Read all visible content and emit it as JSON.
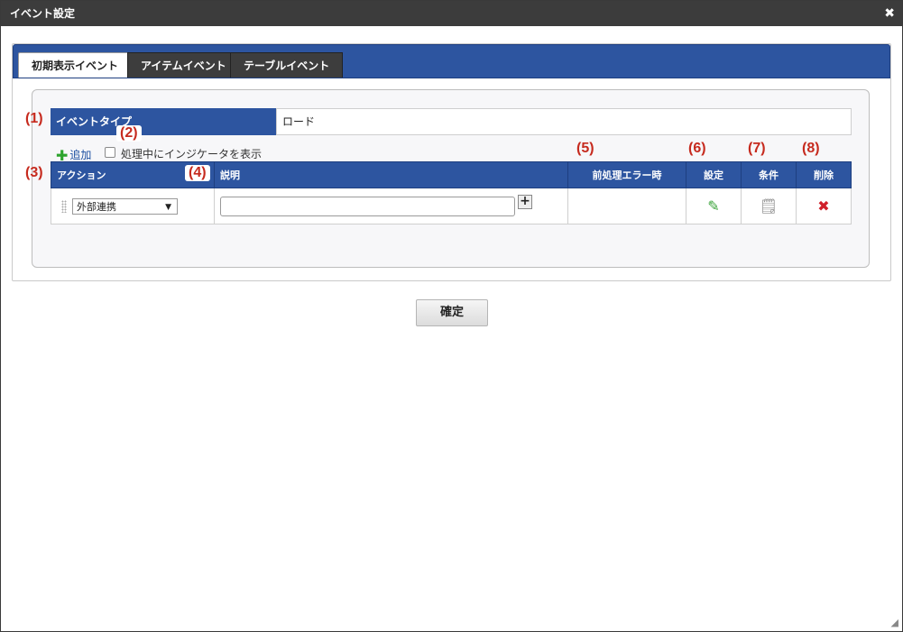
{
  "window": {
    "title": "イベント設定",
    "close_glyph": "✖"
  },
  "tabs": [
    {
      "label": "初期表示イベント"
    },
    {
      "label": "アイテムイベント"
    },
    {
      "label": "テーブルイベント"
    }
  ],
  "event_type": {
    "label": "イベントタイプ",
    "value": "ロード"
  },
  "add_link": {
    "label": "追加"
  },
  "indicator_checkbox": {
    "label": "処理中にインジケータを表示",
    "checked": false
  },
  "table": {
    "headers": {
      "action": "アクション",
      "description": "説明",
      "pre_error": "前処理エラー時",
      "settings": "設定",
      "condition": "条件",
      "delete": "削除"
    },
    "rows": [
      {
        "action_value": "外部連携",
        "description_value": "",
        "pre_error_value": ""
      }
    ]
  },
  "annotations": [
    "(1)",
    "(2)",
    "(3)",
    "(4)",
    "(5)",
    "(6)",
    "(7)",
    "(8)"
  ],
  "confirm_button": {
    "label": "確定"
  },
  "icons": {
    "add": "plus-icon",
    "settings": "pencil-icon",
    "condition": "note-icon",
    "delete": "cross-icon",
    "close": "close-icon"
  },
  "colors": {
    "header_blue": "#2d55a0",
    "title_bar": "#3c3c3c",
    "annotation_red": "#c62a1e"
  }
}
